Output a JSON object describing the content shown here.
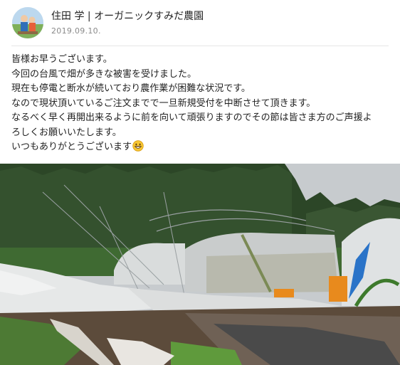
{
  "post": {
    "author": "住田 学 | オーガニックすみだ農園",
    "date": "2019.09.10.",
    "lines": [
      "皆様お早うございます。",
      "今回の台風で畑が多きな被害を受けました。",
      "現在も停電と断水が続いており農作業が困難な状況です。",
      "なので現状頂いているご注文までで一旦新規受付を中断させて頂きます。",
      "なるべく早く再開出来るように前を向いて頑張りますのでその節は皆さま方のご声援よ",
      "ろしくお願いいたします。",
      "いつもありがとうございます"
    ]
  },
  "colors": {
    "sky": "#c9cdd0",
    "trees": "#2f4a2a",
    "soil": "#5a4a3a",
    "plastic": "#e4e6e6"
  },
  "icons": {
    "avatar": "avatar-photo",
    "emoji": "grinning-face-emoji",
    "photo": "typhoon-damaged-greenhouse-photo"
  }
}
